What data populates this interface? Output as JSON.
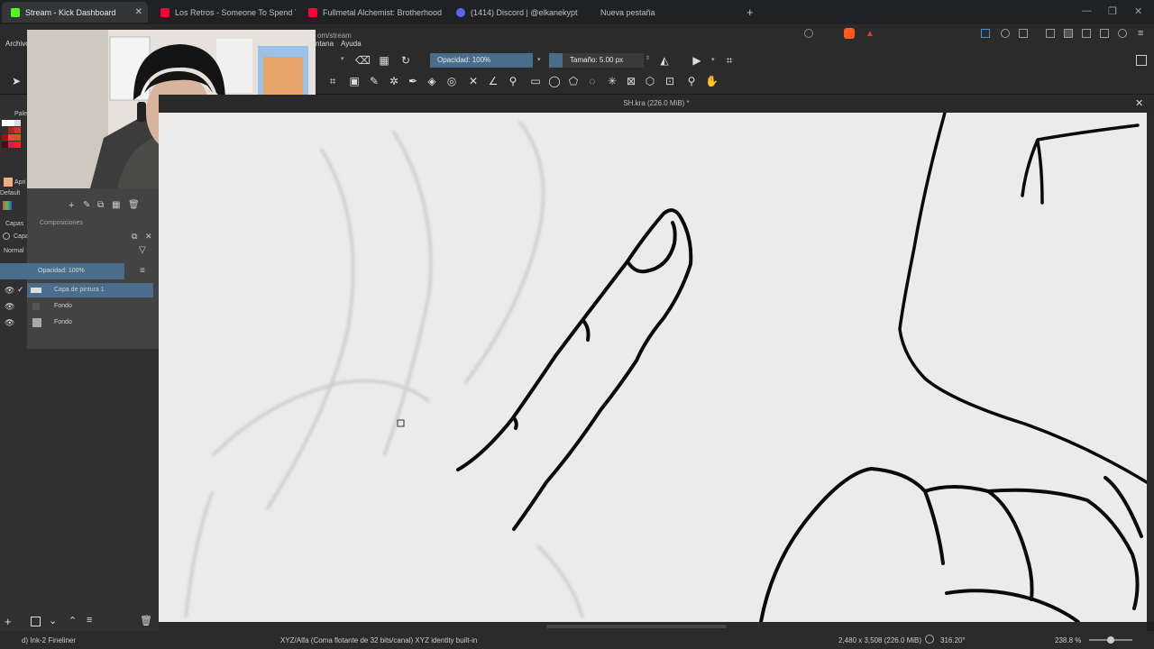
{
  "browser": {
    "tabs": [
      {
        "title": "Stream - Kick Dashboard",
        "color": "#53fc18",
        "active": true
      },
      {
        "title": "Los Retros - Someone To Spend T",
        "color": "#ff0033",
        "active": false
      },
      {
        "title": "Fullmetal Alchemist: Brotherhood All",
        "color": "#ff0033",
        "active": false
      },
      {
        "title": "(1414) Discord | @elkanekypt",
        "color": "#5865f2",
        "active": false
      },
      {
        "title": "Nueva pestaña",
        "color": "",
        "active": false
      }
    ],
    "new_tab": "+",
    "tab_close": "✕"
  },
  "krita": {
    "menu": {
      "archivo": "Archivo",
      "ventana": "ntana",
      "ayuda": "Ayuda",
      "url_fragment": "om/stream"
    },
    "toolbar": {
      "opacity_label": "Opacidad: 100%",
      "size_label": "Tamaño: 5.00 px"
    },
    "document_title": "SH.kra (226.0 MiB) *",
    "left_dock": {
      "palette_label": "Palet",
      "default_label": "Default",
      "april_label": "Apri",
      "layers_tab": "Capas",
      "compositions_tab": "Composiciones",
      "layers_header": "Capa",
      "blend_mode": "Normal",
      "opacity": "Opacidad:  100%",
      "layers": [
        {
          "name": "Capa de pintura 1",
          "selected": true
        },
        {
          "name": "Fondo",
          "selected": false
        },
        {
          "name": "Fondo",
          "selected": false
        }
      ]
    },
    "status": {
      "brush": "d) Ink-2 Fineliner",
      "colorspace": "XYZ/Alfa (Coma flotante de 32 bits/canal)  XYZ identity built-in",
      "dimensions": "2,480 x 3,508 (226.0 MiB)",
      "rotation": "316.20°",
      "zoom": "238.8 %"
    }
  },
  "colors": {
    "accent": "#4a6d8c",
    "kick_green": "#53fc18"
  }
}
